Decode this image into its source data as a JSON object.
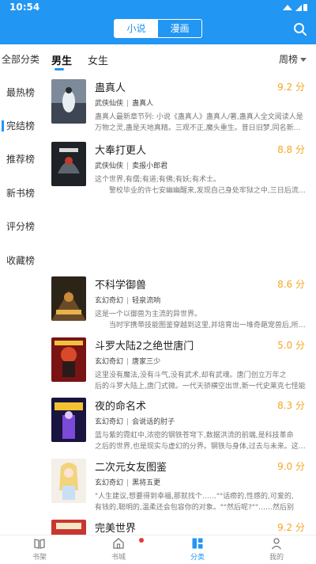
{
  "status": {
    "time": "10:54"
  },
  "header": {
    "tabs": [
      "小说",
      "漫画"
    ],
    "active_tab": 0
  },
  "sidebar": {
    "items": [
      "全部分类",
      "最热榜",
      "完结榜",
      "推荐榜",
      "新书榜",
      "评分榜",
      "收藏榜"
    ],
    "active": 2
  },
  "gender_tabs": [
    "男生",
    "女生"
  ],
  "rank_select": "周榜",
  "books": [
    {
      "title": "蛊真人",
      "score": "9.2 分",
      "category": "武侠仙侠",
      "author": "蛊真人",
      "desc": "蛊真人最新章节列: 小说《蛊真人》蛊真人/著,蛊真人全文阅读人是\n万物之灵,蛊是天地真精。三观不正,魔头重生。昔日旧梦,同名新…"
    },
    {
      "title": "大奉打更人",
      "score": "8.8 分",
      "category": "武侠仙侠",
      "author": "卖报小郎君",
      "desc": "这个世界,有儒;有道;有佛;有妖;有术士。\n　　警校毕业的许七安幽幽醒来,发现自己身处牢狱之中,三日后流…"
    },
    {
      "title": "不科学御兽",
      "score": "8.6 分",
      "category": "玄幻奇幻",
      "author": "轻泉流响",
      "desc": "这是一个以御兽为主流的异世界。\n　　当时宇携带技能图鉴穿越到这里,并培育出一堆奇葩宠兽后,所…"
    },
    {
      "title": "斗罗大陆2之绝世唐门",
      "score": "5.0 分",
      "category": "玄幻奇幻",
      "author": "唐家三少",
      "desc": "这里没有魔法,没有斗气,没有武术,却有武魂。唐门创立万年之\n后的斗罗大陆上,唐门式微。一代天骄横空出世,新一代史莱克七怪能否…"
    },
    {
      "title": "夜的命名术",
      "score": "8.3 分",
      "category": "玄幻奇幻",
      "author": "会说话的肘子",
      "desc": "蓝与紫的霓虹中,浓密的钢铁苍穹下,数据洪流的前端,是科技革命\n之后的世界,也是现实与虚幻的分界。钢铁与身体,过去与未来。这…"
    },
    {
      "title": "二次元女友图鉴",
      "score": "9.0 分",
      "category": "玄幻奇幻",
      "author": "黑将五更",
      "desc": "\"人生建议,想要得到幸福,那就找个……\"\"话痨的,性感的,可爱的,\n有钱的,聪明的,温柔还会包容你的对象。\"\"然后呢?\"\"……然后别让…"
    },
    {
      "title": "完美世界",
      "score": "9.2 分",
      "category": "",
      "author": "",
      "desc": ""
    }
  ],
  "bottom_nav": [
    {
      "label": "书架",
      "icon": "bookshelf-icon"
    },
    {
      "label": "书城",
      "icon": "bookstore-icon"
    },
    {
      "label": "分类",
      "icon": "category-icon"
    },
    {
      "label": "我的",
      "icon": "profile-icon"
    }
  ],
  "bottom_active": 2,
  "colors": {
    "accent": "#2196f3",
    "score": "#f5a623",
    "badge": "#e53935"
  }
}
